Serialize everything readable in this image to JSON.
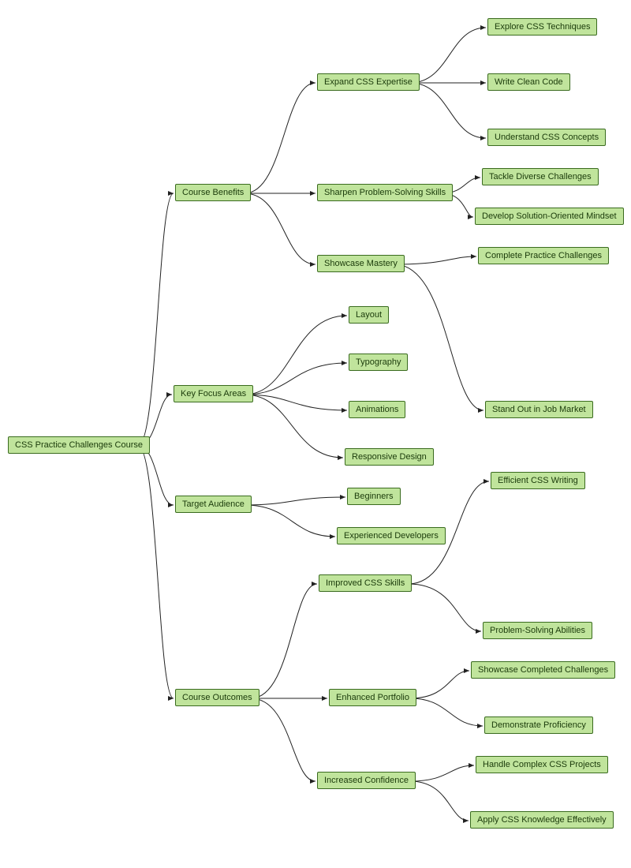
{
  "chart_data": {
    "type": "tree",
    "root": "CSS Practice Challenges Course",
    "children": [
      {
        "label": "Course Benefits",
        "children": [
          {
            "label": "Expand CSS Expertise",
            "children": [
              {
                "label": "Explore CSS Techniques"
              },
              {
                "label": "Write Clean Code"
              },
              {
                "label": "Understand CSS Concepts"
              }
            ]
          },
          {
            "label": "Sharpen Problem-Solving Skills",
            "children": [
              {
                "label": "Tackle Diverse Challenges"
              },
              {
                "label": "Develop Solution-Oriented Mindset"
              }
            ]
          },
          {
            "label": "Showcase Mastery",
            "children": [
              {
                "label": "Complete Practice Challenges"
              },
              {
                "label": "Stand Out in Job Market"
              }
            ]
          }
        ]
      },
      {
        "label": "Key Focus Areas",
        "children": [
          {
            "label": "Layout"
          },
          {
            "label": "Typography"
          },
          {
            "label": "Animations"
          },
          {
            "label": "Responsive Design"
          }
        ]
      },
      {
        "label": "Target Audience",
        "children": [
          {
            "label": "Beginners"
          },
          {
            "label": "Experienced Developers"
          }
        ]
      },
      {
        "label": "Course Outcomes",
        "children": [
          {
            "label": "Improved CSS Skills",
            "children": [
              {
                "label": "Efficient CSS Writing"
              },
              {
                "label": "Problem-Solving Abilities"
              }
            ]
          },
          {
            "label": "Enhanced Portfolio",
            "children": [
              {
                "label": "Showcase Completed Challenges"
              },
              {
                "label": "Demonstrate Proficiency"
              }
            ]
          },
          {
            "label": "Increased Confidence",
            "children": [
              {
                "label": "Handle Complex CSS Projects"
              },
              {
                "label": "Apply CSS Knowledge Effectively"
              }
            ]
          }
        ]
      }
    ]
  },
  "nodes": {
    "root": "CSS Practice Challenges Course",
    "benefits": "Course Benefits",
    "expand": "Expand CSS Expertise",
    "explore": "Explore CSS Techniques",
    "clean": "Write Clean Code",
    "understand": "Understand CSS Concepts",
    "sharpen": "Sharpen Problem-Solving Skills",
    "tackle": "Tackle Diverse Challenges",
    "mindset": "Develop Solution-Oriented Mindset",
    "showcase": "Showcase Mastery",
    "complete": "Complete Practice Challenges",
    "standout": "Stand Out in Job Market",
    "focus": "Key Focus Areas",
    "layout": "Layout",
    "typo": "Typography",
    "anim": "Animations",
    "responsive": "Responsive Design",
    "audience": "Target Audience",
    "beginners": "Beginners",
    "experienced": "Experienced Developers",
    "outcomes": "Course Outcomes",
    "improved": "Improved CSS Skills",
    "efficient": "Efficient CSS Writing",
    "problem": "Problem-Solving Abilities",
    "portfolio": "Enhanced Portfolio",
    "showcasech": "Showcase Completed Challenges",
    "demonstrate": "Demonstrate Proficiency",
    "confidence": "Increased Confidence",
    "complex": "Handle Complex CSS Projects",
    "apply": "Apply CSS Knowledge Effectively"
  },
  "colors": {
    "nodeFill": "#c0e49c",
    "nodeBorder": "#3a6b1f",
    "edge": "#222"
  }
}
